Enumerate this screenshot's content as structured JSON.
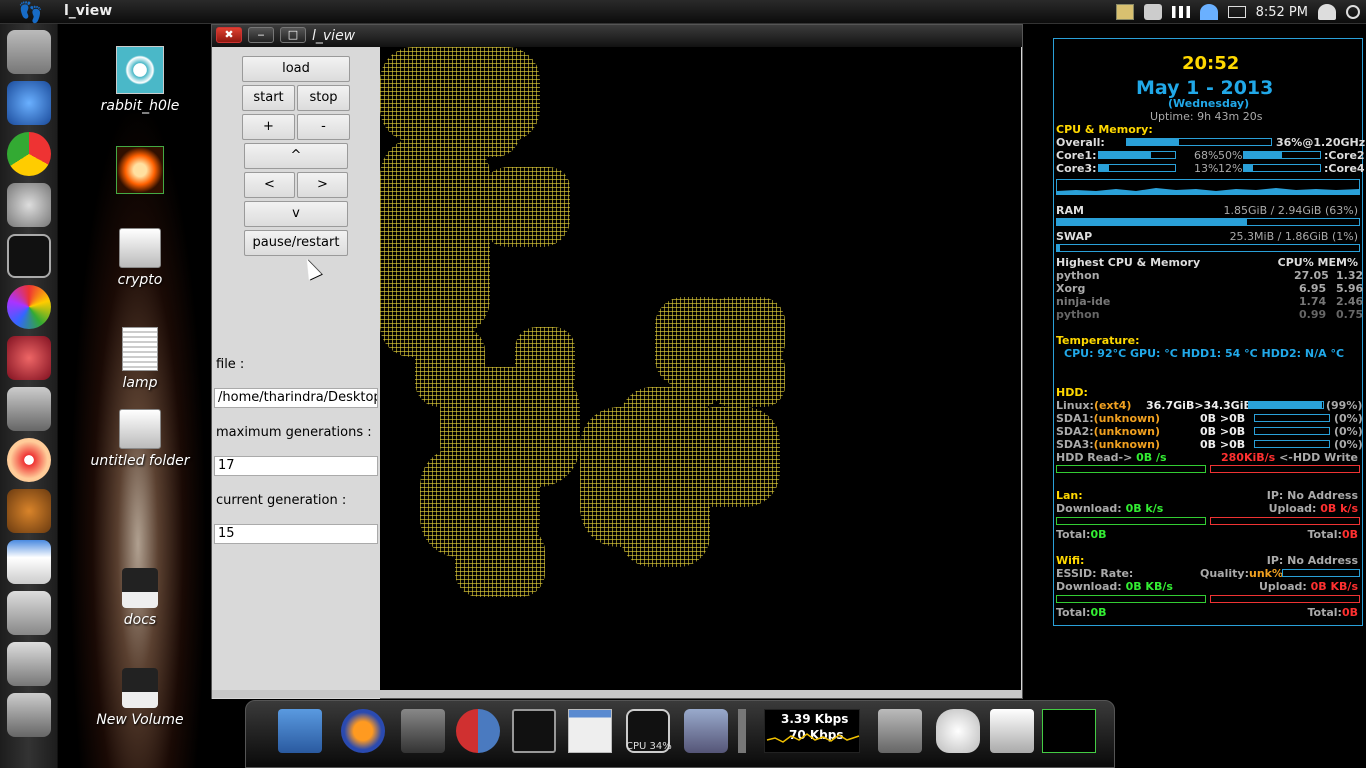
{
  "top_panel": {
    "app_title": "l_view",
    "clock": "8:52 PM"
  },
  "desktop_icons": [
    {
      "label": "rabbit_h0le",
      "icon": "spiral-image-icon"
    },
    {
      "label": "",
      "icon": "skull-image-icon"
    },
    {
      "label": "crypto",
      "icon": "folder-icon"
    },
    {
      "label": "lamp",
      "icon": "text-file-icon"
    },
    {
      "label": "untitled folder",
      "icon": "folder-icon"
    },
    {
      "label": "docs",
      "icon": "drive-icon"
    },
    {
      "label": "New Volume",
      "icon": "drive-icon"
    }
  ],
  "window": {
    "title": "l_view",
    "buttons": {
      "load": "load",
      "start": "start",
      "stop": "stop",
      "plus": "+",
      "minus": "-",
      "up": "^",
      "left": "<",
      "right": ">",
      "down": "v",
      "pause": "pause/restart"
    },
    "file_label": "file :",
    "file_value": "/home/tharindra/Desktop/r",
    "max_gen_label": "maximum generations :",
    "max_gen_value": "17",
    "cur_gen_label": "current generation :",
    "cur_gen_value": "15"
  },
  "conky": {
    "time": "20:52",
    "date": "May  1 - 2013",
    "weekday": "(Wednesday)",
    "uptime": "Uptime: 9h 43m 20s",
    "cpu_mem_title": "CPU & Memory:",
    "overall_label": "Overall:",
    "overall_value": "36%@1.20GHz",
    "overall_pct": 36,
    "core1_label": "Core1:",
    "core1_pct_text": "68%",
    "core1_pct": 68,
    "core2_pct_text": "50%",
    "core2_pct": 50,
    "core2_label": ":Core2",
    "core3_label": "Core3:",
    "core3_pct_text": "13%",
    "core3_pct": 13,
    "core4_pct_text": "12%",
    "core4_pct": 12,
    "core4_label": ":Core4",
    "ram_label": "RAM",
    "ram_value": "1.85GiB / 2.94GiB (63%)",
    "ram_pct": 63,
    "swap_label": "SWAP",
    "swap_value": "25.3MiB / 1.86GiB (1%)",
    "swap_pct": 1,
    "highest_title": "Highest CPU & Memory",
    "highest_cols": "CPU% MEM%",
    "processes": [
      {
        "name": "python",
        "cpu": "27.05",
        "mem": "1.32"
      },
      {
        "name": "Xorg",
        "cpu": "6.95",
        "mem": "5.96"
      },
      {
        "name": "ninja-ide",
        "cpu": "1.74",
        "mem": "2.46"
      },
      {
        "name": "python",
        "cpu": "0.99",
        "mem": "0.75"
      }
    ],
    "temp_title": "Temperature:",
    "temp_line": "CPU: 92°C  GPU:  °C  HDD1: 54 °C  HDD2: N/A °C",
    "hdd_title": "HDD:",
    "hdd_rows": [
      {
        "name": "Linux:",
        "fs": "(ext4)",
        "used": "36.7GiB>34.3GiB",
        "pct": "(99%)",
        "fill": 99
      },
      {
        "name": "SDA1:",
        "fs": "(unknown)",
        "used": "0B  >0B",
        "pct": "(0%)",
        "fill": 0
      },
      {
        "name": "SDA2:",
        "fs": "(unknown)",
        "used": "0B  >0B",
        "pct": "(0%)",
        "fill": 0
      },
      {
        "name": "SDA3:",
        "fs": "(unknown)",
        "used": "0B  >0B",
        "pct": "(0%)",
        "fill": 0
      }
    ],
    "hdd_read": "HDD Read->",
    "hdd_read_value": "0B  /s",
    "hdd_write_value": "280KiB/s",
    "hdd_write": "<-HDD Write",
    "lan_title": "Lan:",
    "lan_ip": "IP: No Address",
    "lan_download": "Download:",
    "lan_download_value": "0B   k/s",
    "lan_upload": "Upload:",
    "lan_upload_value": "0B   k/s",
    "lan_total_left": "Total:",
    "lan_total_left_value": "0B",
    "lan_total_right": "Total:",
    "lan_total_right_value": "0B",
    "wifi_title": "Wifi:",
    "wifi_ip": "IP: No Address",
    "wifi_essid": "ESSID: Rate:",
    "wifi_quality": "Quality:",
    "wifi_quality_value": "unk%",
    "wifi_download": "Download:",
    "wifi_download_value": "0B  KB/s",
    "wifi_upload": "Upload:",
    "wifi_upload_value": "0B  KB/s",
    "wifi_total_left": "Total:",
    "wifi_total_left_value": "0B",
    "wifi_total_right": "Total:",
    "wifi_total_right_value": "0B"
  },
  "bottom_dock": {
    "net_up": "3.39 Kbps",
    "net_down": "70 Kbps",
    "cpu_label": "CPU 34%"
  }
}
